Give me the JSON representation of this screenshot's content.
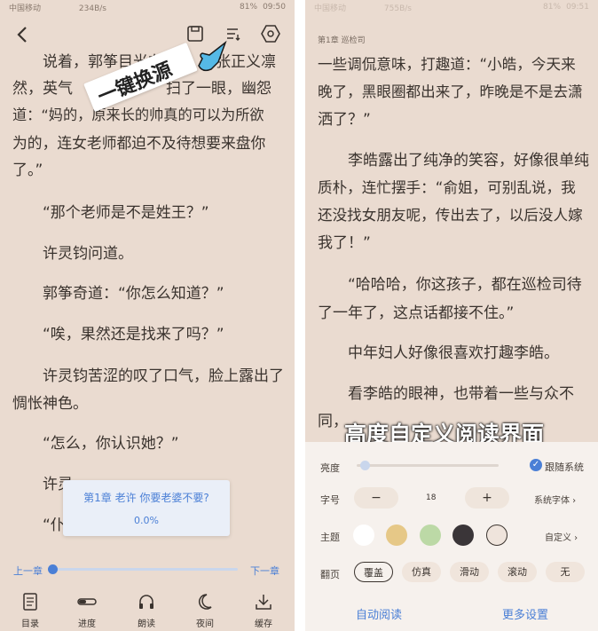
{
  "left": {
    "status_bar": {
      "carrier": "中国移动",
      "speed": "234B/s",
      "battery": "81%",
      "time": "09:50"
    },
    "top_icons": [
      "back-arrow-icon",
      "save-icon",
      "source-switch-icon",
      "settings-hexagon-icon"
    ],
    "paragraphs": [
      "说着，郭筝目光在",
      "张正义凛",
      "然，英气",
      "扫了一眼，幽怨",
      "道：“妈的，原来长的帅真的可以为所欲",
      "为的，连女老师都迫不及待想要来盘你",
      "了。”",
      "“那个老师是不是姓王？”",
      "许灵钧问道。",
      "郭筝奇道：“你怎么知道？”",
      "“唉，果然还是找来了吗？”",
      "许灵钧苦涩的叹了口气，脸上露出了",
      "惆怅神色。",
      "“怎么，你认识她？”",
      "许灵",
      "“仆"
    ],
    "overlay_label": "一键换源",
    "popup": {
      "chapter": "第1章 老许 你要老婆不要?",
      "progress": "0.0%"
    },
    "prev_chapter": "上一章",
    "next_chapter": "下一章",
    "slider_value": 0,
    "toolbar": [
      {
        "icon": "catalog-icon",
        "label": "目录"
      },
      {
        "icon": "progress-icon",
        "label": "进度"
      },
      {
        "icon": "headphones-icon",
        "label": "朗读"
      },
      {
        "icon": "moon-icon",
        "label": "夜间"
      },
      {
        "icon": "download-icon",
        "label": "缓存"
      }
    ]
  },
  "right": {
    "status_bar": {
      "carrier": "中国移动",
      "speed": "755B/s",
      "battery": "81%",
      "time": "09:51"
    },
    "chapter_header": "第1章 巡检司",
    "paragraphs": [
      "一些调侃意味，打趣道：“小皓，今天来",
      "晚了，黑眼圈都出来了，昨晚是不是去潇",
      "洒了？”",
      "李皓露出了纯净的笑容，好像很单纯",
      "质朴，连忙摆手：“俞姐，可别乱说，我",
      "还没找女朋友呢，传出去了，以后没人嫁",
      "我了！”",
      "“哈哈哈，你这孩子，都在巡检司待",
      "了一年了，这点话都接不住。”",
      "中年妇人好像很喜欢打趣李皓。",
      "看李皓的眼神，也带着一些与众不",
      "同，"
    ],
    "overlay_label": "高度自定义阅读界面",
    "settings": {
      "brightness_label": "亮度",
      "follow_system_label": "跟随系统",
      "follow_system_checked": true,
      "brightness_value": 0.06,
      "font_size_label": "字号",
      "decrease": "−",
      "font_size_value": "18",
      "increase": "+",
      "system_font": "系统字体 ›",
      "theme_label": "主题",
      "themes": [
        "#ffffff",
        "#e6c887",
        "#bcd9a6",
        "#3a3538",
        "#efe4dc"
      ],
      "custom": "自定义 ›",
      "page_turn_label": "翻页",
      "page_modes": [
        "覆盖",
        "仿真",
        "滑动",
        "滚动",
        "无"
      ],
      "selected_mode": "覆盖",
      "auto_read": "自动阅读",
      "more_settings": "更多设置"
    }
  }
}
